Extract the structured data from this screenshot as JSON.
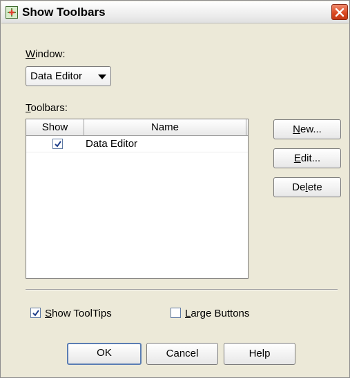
{
  "window": {
    "title": "Show Toolbars",
    "close_icon": "close-icon"
  },
  "window_select": {
    "label_mnemonic": "W",
    "label_rest": "indow:",
    "value": "Data Editor"
  },
  "toolbars": {
    "label_mnemonic": "T",
    "label_rest": "oolbars:",
    "columns": [
      "Show",
      "Name"
    ],
    "rows": [
      {
        "show": true,
        "name": "Data Editor"
      }
    ]
  },
  "side_buttons": {
    "new": {
      "mnemonic": "N",
      "rest": "ew..."
    },
    "edit": {
      "mnemonic": "E",
      "rest": "dit..."
    },
    "delete": {
      "pre": "De",
      "mnemonic": "l",
      "rest": "ete"
    }
  },
  "options": {
    "show_tooltips": {
      "checked": true,
      "mnemonic": "S",
      "rest": "how ToolTips"
    },
    "large_buttons": {
      "checked": false,
      "mnemonic": "L",
      "rest": "arge Buttons"
    }
  },
  "buttons": {
    "ok": "OK",
    "cancel": "Cancel",
    "help": "Help"
  },
  "colors": {
    "dialog_bg": "#ece9d8",
    "close_button": "#d8461f",
    "checkbox_border": "#5f7aa3",
    "checkmark": "#1f3f8a",
    "default_button_border": "#5a7db3"
  }
}
